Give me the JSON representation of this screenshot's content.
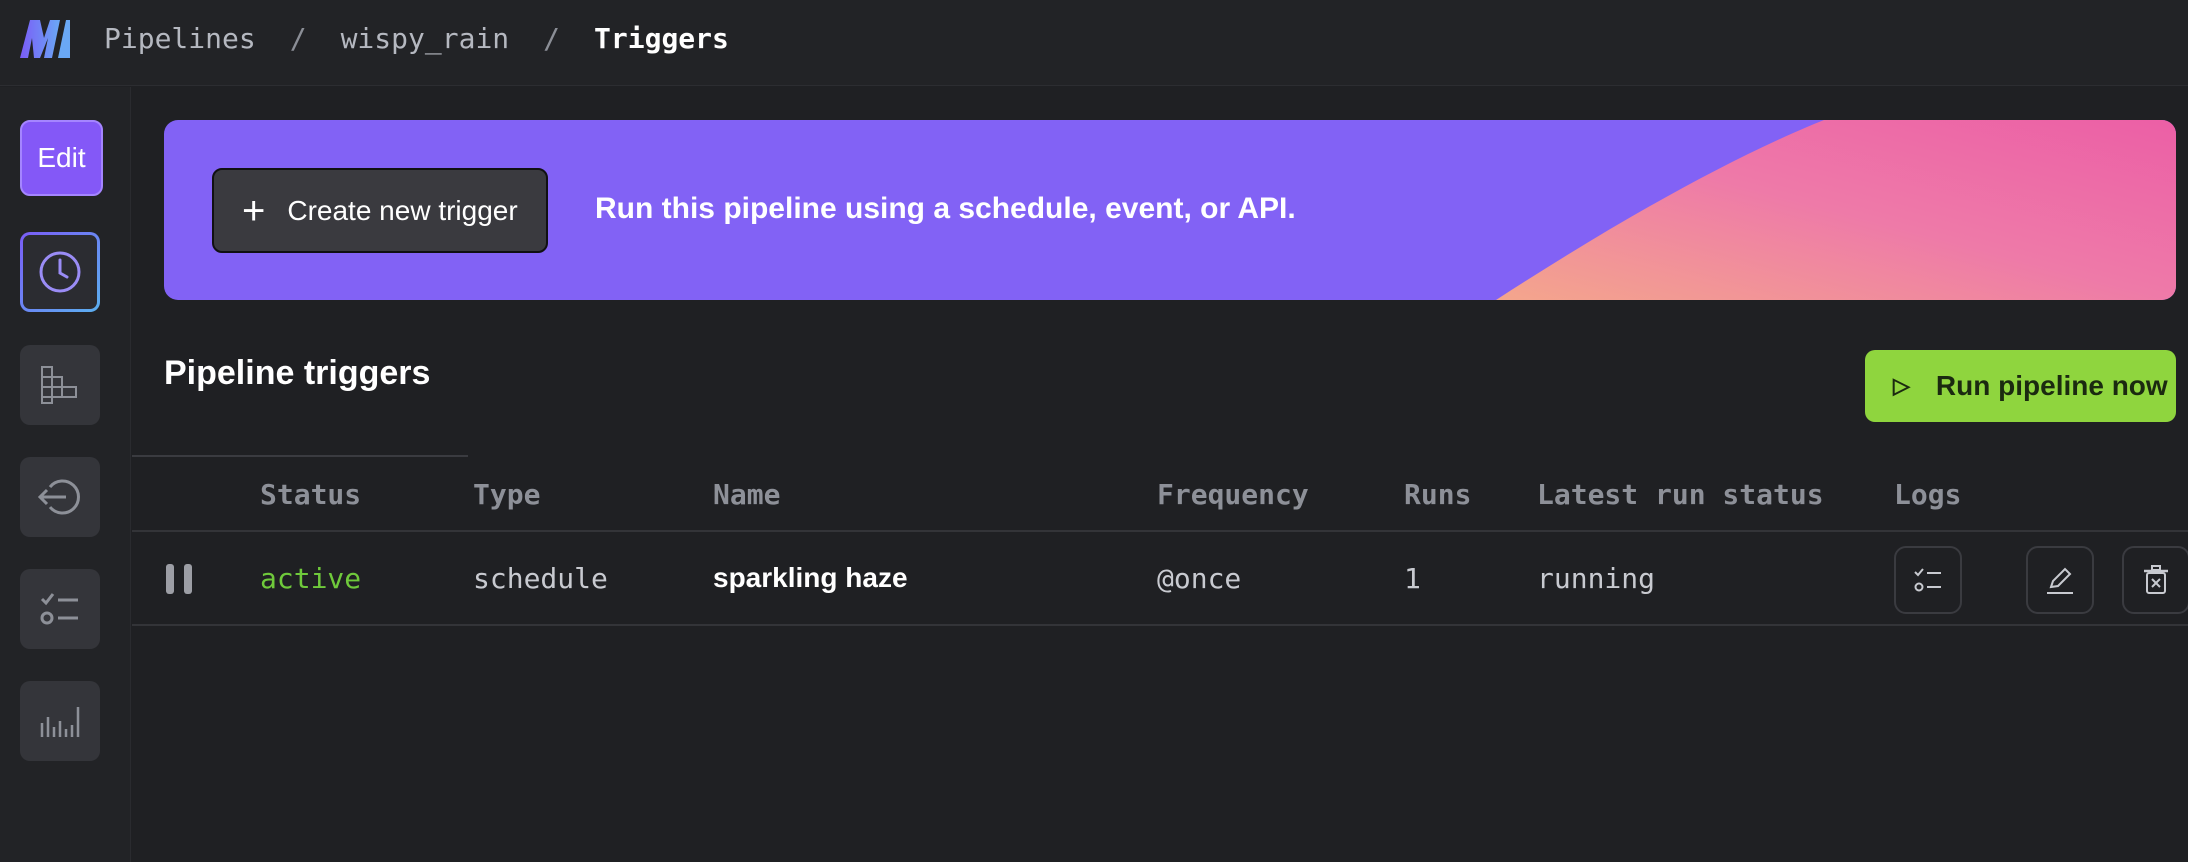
{
  "breadcrumb": {
    "items": [
      "Pipelines",
      "wispy_rain"
    ],
    "separator": "/",
    "current": "Triggers"
  },
  "sidebar": {
    "edit_label": "Edit",
    "items": [
      "clock-icon",
      "blocks-icon",
      "back-arrow-icon",
      "checklist-icon",
      "bar-chart-icon"
    ]
  },
  "banner": {
    "create_label": "Create new trigger",
    "text": "Run this pipeline using a schedule, event, or API."
  },
  "section": {
    "title": "Pipeline triggers",
    "run_label": "Run pipeline now"
  },
  "table": {
    "headers": [
      "Status",
      "Type",
      "Name",
      "Frequency",
      "Runs",
      "Latest run status",
      "Logs"
    ],
    "rows": [
      {
        "status": "active",
        "type": "schedule",
        "name": "sparkling haze",
        "frequency": "@once",
        "runs": "1",
        "latest_run_status": "running"
      }
    ]
  },
  "colors": {
    "accent": "#8458f7",
    "banner": "#8262f5",
    "run_button": "#8fd53e",
    "active_status": "#6fc93b"
  }
}
